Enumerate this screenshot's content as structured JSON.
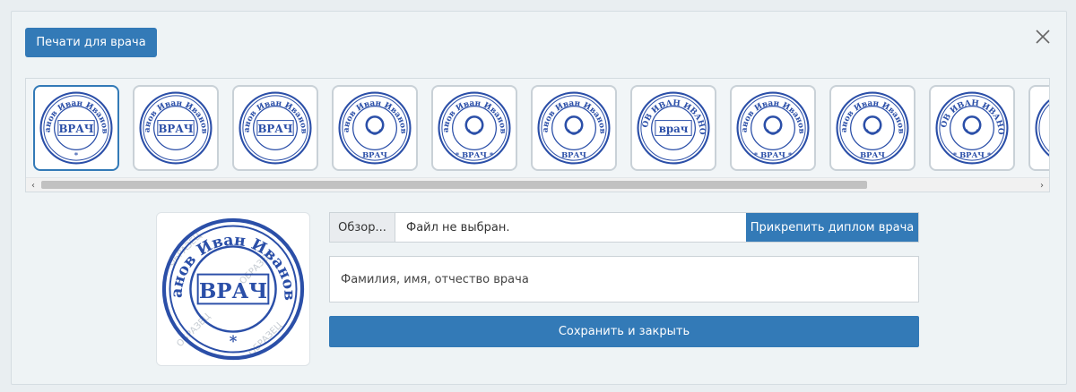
{
  "header": {
    "title": "Печати для врача"
  },
  "icons": {
    "close": "close-icon"
  },
  "stamps": [
    {
      "top_text": "Иванов Иван Иванович",
      "center": "ВРАЧ",
      "bottom": "*",
      "style": "a"
    },
    {
      "top_text": "Иванов Иван Иванович",
      "center": "ВРАЧ",
      "bottom": "",
      "style": "b"
    },
    {
      "top_text": "Иванов Иван Иванович",
      "center": "ВРАЧ",
      "bottom": "",
      "style": "b"
    },
    {
      "top_text": "Иванов Иван Иванович",
      "center": "",
      "bottom": "ВРАЧ",
      "style": "c"
    },
    {
      "top_text": "Иванов Иван Иванович",
      "center": "",
      "bottom": "* ВРАЧ *",
      "style": "d"
    },
    {
      "top_text": "Иванов Иван Иванович",
      "center": "",
      "bottom": "ВРАЧ",
      "style": "e"
    },
    {
      "top_text": "ИВАНОВ ИВАН ИВАНОВИЧ",
      "center": "врач",
      "bottom": "",
      "style": "f"
    },
    {
      "top_text": "Иванов Иван Иванович",
      "center": "",
      "bottom": "* ВРАЧ *",
      "style": "g"
    },
    {
      "top_text": "Иванов Иван Иванович",
      "center": "",
      "bottom": "ВРАЧ",
      "style": "h"
    },
    {
      "top_text": "ИВАНОВ ИВАН ИВАНОВИЧ",
      "center": "",
      "bottom": "* ВРАЧ *",
      "style": "i"
    },
    {
      "top_text": "",
      "center": "",
      "bottom": "",
      "style": "j"
    }
  ],
  "scrollbar": {
    "left_arrow": "‹",
    "right_arrow": "›"
  },
  "preview": {
    "top_text": "Иванов Иван Иванович",
    "center": "ВРАЧ",
    "bottom": "*",
    "watermark": "ОБРАЗЕЦ"
  },
  "file": {
    "browse_label": "Обзор...",
    "status": "Файл не выбран.",
    "attach_label": "Прикрепить диплом врача"
  },
  "form": {
    "name_placeholder": "Фамилия, имя, отчество врача",
    "save_label": "Сохранить и закрыть"
  },
  "colors": {
    "accent": "#337ab7",
    "stamp": "#2b4fa8"
  }
}
